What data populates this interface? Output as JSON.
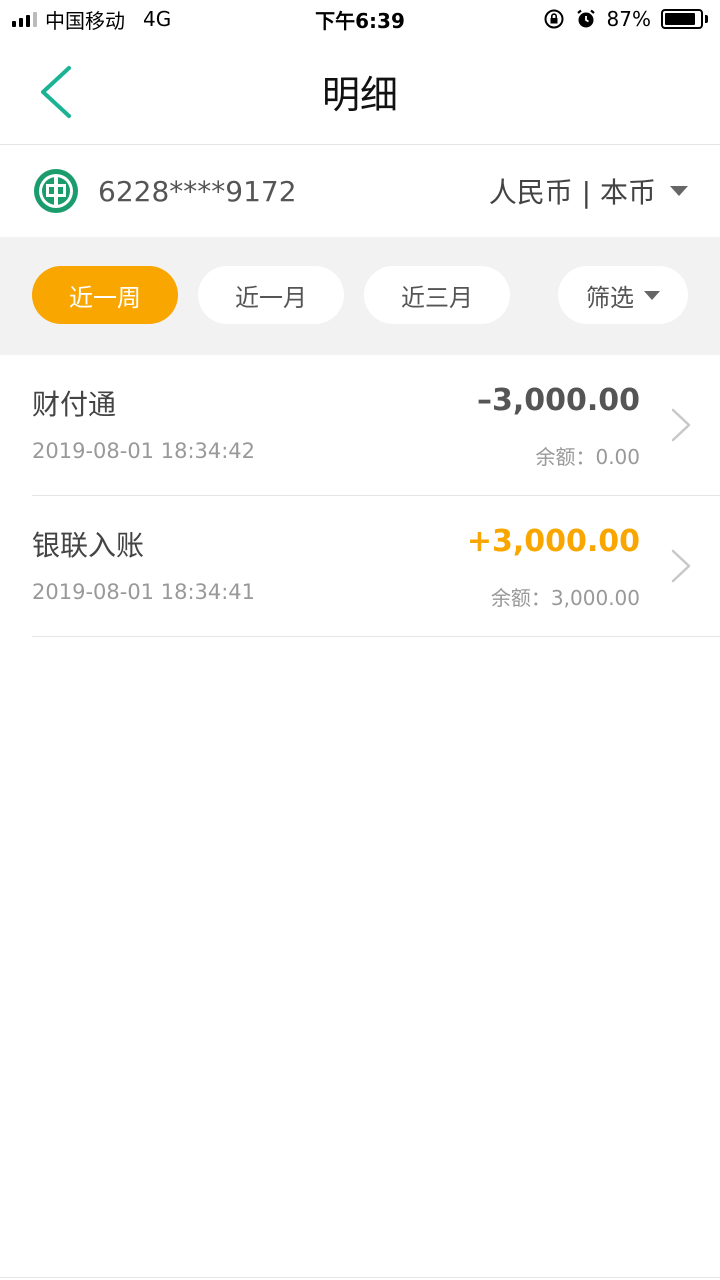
{
  "status_bar": {
    "carrier": "中国移动",
    "network": "4G",
    "time": "下午6:39",
    "battery_percent": "87%",
    "battery_level": 0.87
  },
  "nav": {
    "title": "明细"
  },
  "account": {
    "number": "6228****9172",
    "currency_label": "人民币 | 本币"
  },
  "filters": {
    "week": "近一周",
    "month": "近一月",
    "three_months": "近三月",
    "filter": "筛选",
    "active": "week"
  },
  "transactions": [
    {
      "name": "财付通",
      "time": "2019-08-01 18:34:42",
      "amount": "–3,000.00",
      "balance": "余额：0.00",
      "direction": "out"
    },
    {
      "name": "银联入账",
      "time": "2019-08-01 18:34:41",
      "amount": "+3,000.00",
      "balance": "余额：3,000.00",
      "direction": "in"
    }
  ],
  "colors": {
    "accent": "#f9a600",
    "back_arrow": "#1ab394",
    "bank_logo": "#1a9c6c"
  }
}
